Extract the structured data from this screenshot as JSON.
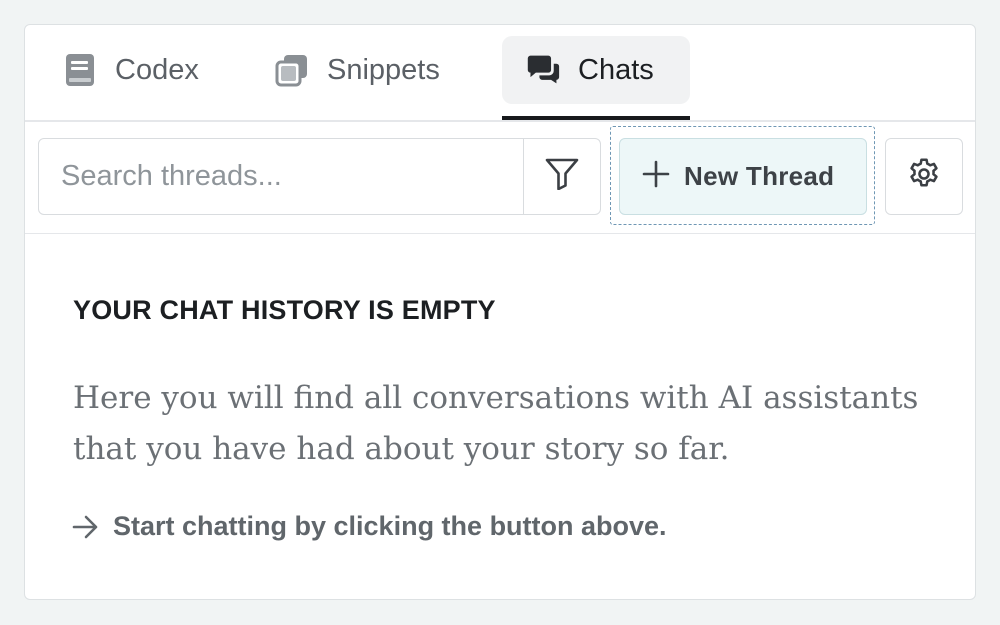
{
  "tabs": [
    {
      "label": "Codex",
      "icon": "book-icon",
      "active": false
    },
    {
      "label": "Snippets",
      "icon": "snippets-icon",
      "active": false
    },
    {
      "label": "Chats",
      "icon": "chat-bubbles-icon",
      "active": true
    }
  ],
  "toolbar": {
    "search_placeholder": "Search threads...",
    "filter_icon": "filter-icon",
    "new_thread_label": "New Thread",
    "new_thread_icon": "plus-icon",
    "settings_icon": "gear-icon"
  },
  "empty_state": {
    "title": "YOUR CHAT HISTORY IS EMPTY",
    "description": "Here you will find all conversations with AI assistants that you have had about your story so far.",
    "hint": "Start chatting by clicking the button above.",
    "hint_icon": "arrow-right-icon"
  },
  "colors": {
    "accent_bg": "#edf7f8",
    "active_tab_underline": "#17191c",
    "focus_ring": "#6f97b4"
  }
}
